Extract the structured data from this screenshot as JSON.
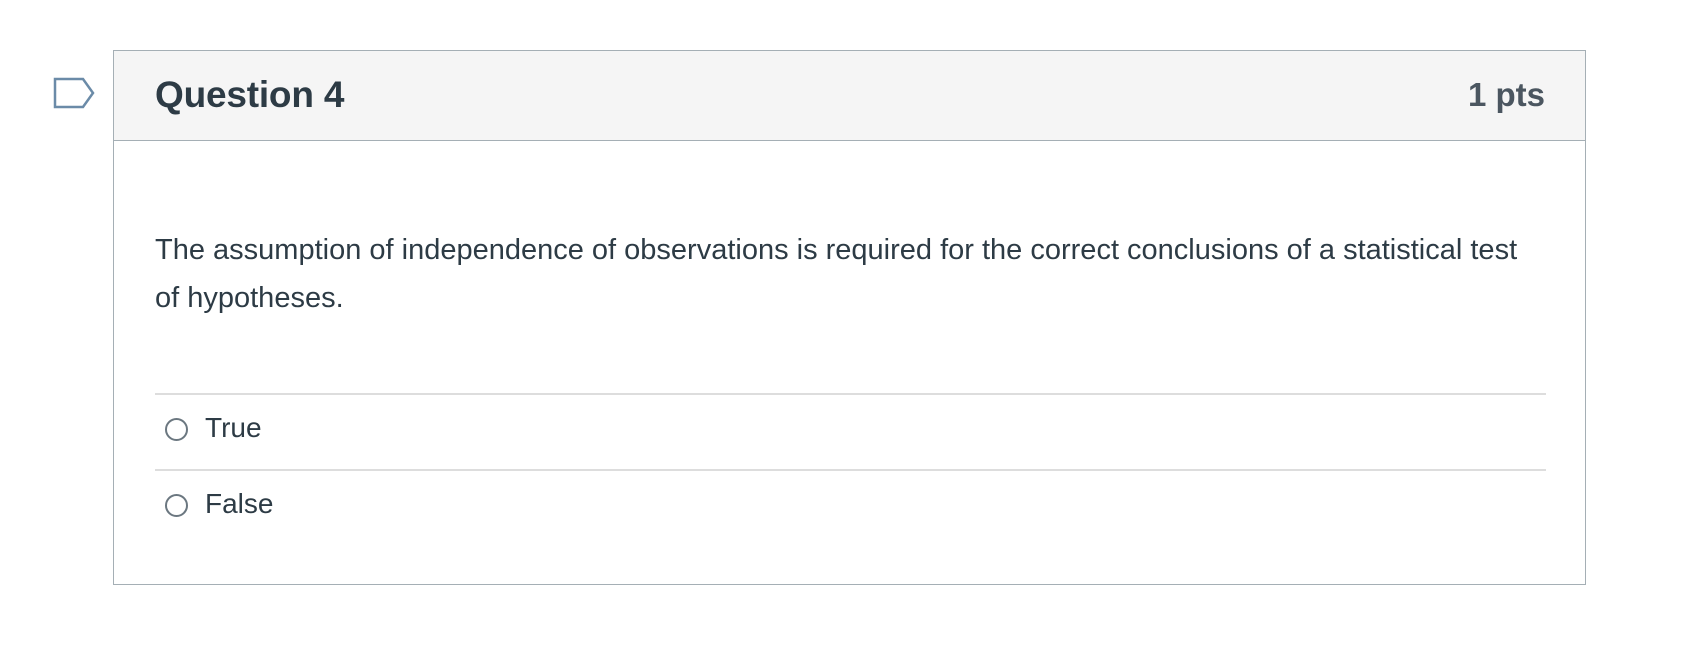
{
  "question": {
    "title": "Question 4",
    "points": "1 pts",
    "text": "The assumption of independence of observations is required for the correct conclusions of a statistical test of hypotheses.",
    "flag_icon": "flag-question-icon",
    "answers": [
      {
        "label": "True",
        "selected": false
      },
      {
        "label": "False",
        "selected": false
      }
    ]
  },
  "colors": {
    "header_bg": "#f5f5f5",
    "border": "#a5afb5",
    "text": "#2d3b45",
    "flag": "#6b8ba8"
  }
}
